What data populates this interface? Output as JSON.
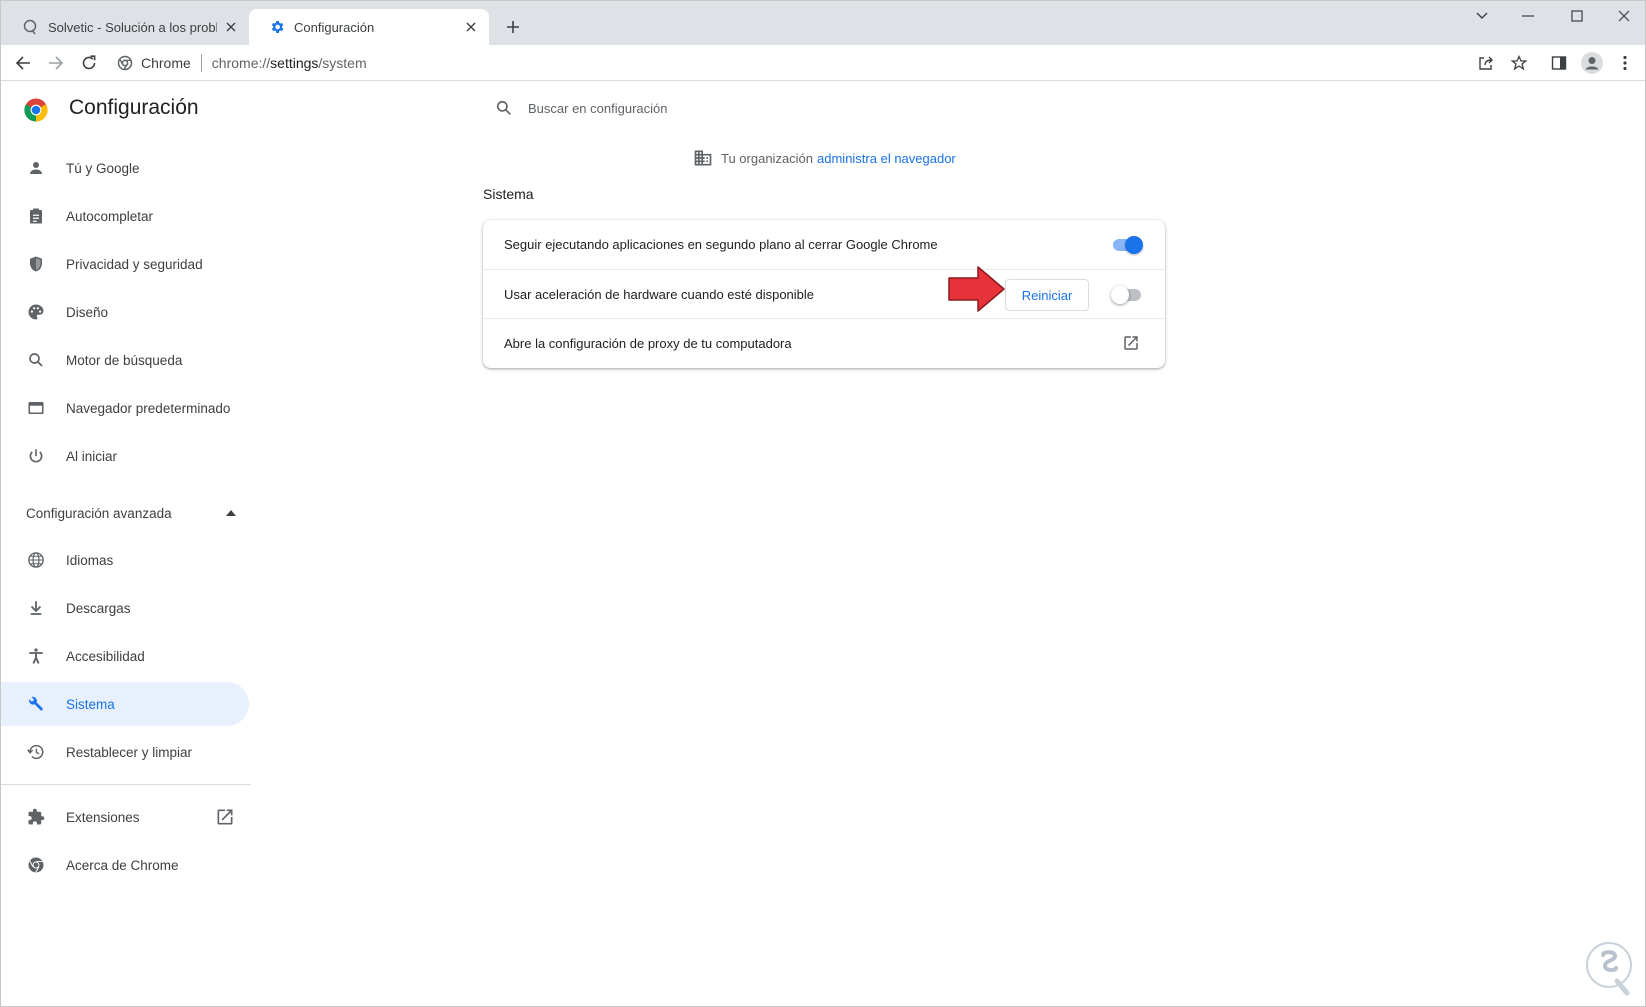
{
  "browser": {
    "tabs": [
      {
        "title": "Solvetic - Solución a los problem",
        "favicon": "solvetic-favicon",
        "active": false
      },
      {
        "title": "Configuración",
        "favicon": "settings-gear-icon",
        "active": true
      }
    ],
    "omnibox": {
      "site_name": "Chrome",
      "url_scheme": "chrome://",
      "url_host": "settings",
      "url_path": "/system"
    }
  },
  "settings": {
    "title": "Configuración",
    "search_placeholder": "Buscar en configuración",
    "nav_items": [
      {
        "label": "Tú y Google",
        "icon": "person-icon"
      },
      {
        "label": "Autocompletar",
        "icon": "assignment-icon"
      },
      {
        "label": "Privacidad y seguridad",
        "icon": "shield-icon"
      },
      {
        "label": "Diseño",
        "icon": "palette-icon"
      },
      {
        "label": "Motor de búsqueda",
        "icon": "search-icon"
      },
      {
        "label": "Navegador predeterminado",
        "icon": "web-browser-icon"
      },
      {
        "label": "Al iniciar",
        "icon": "power-icon"
      }
    ],
    "advanced_header": "Configuración avanzada",
    "advanced_items": [
      {
        "label": "Idiomas",
        "icon": "globe-icon"
      },
      {
        "label": "Descargas",
        "icon": "download-icon"
      },
      {
        "label": "Accesibilidad",
        "icon": "accessibility-icon"
      },
      {
        "label": "Sistema",
        "icon": "wrench-icon",
        "active": true
      },
      {
        "label": "Restablecer y limpiar",
        "icon": "restore-icon"
      }
    ],
    "footer_items": [
      {
        "label": "Extensiones",
        "icon": "puzzle-icon"
      },
      {
        "label": "Acerca de Chrome",
        "icon": "chrome-icon"
      }
    ]
  },
  "main": {
    "managed_notice": {
      "text": "Tu organización",
      "link": "administra el navegador"
    },
    "section_title": "Sistema",
    "rows": [
      {
        "label": "Seguir ejecutando aplicaciones en segundo plano al cerrar Google Chrome",
        "toggle": true
      },
      {
        "label": "Usar aceleración de hardware cuando esté disponible",
        "toggle": false,
        "button": "Reiniciar"
      },
      {
        "label": "Abre la configuración de proxy de tu computadora",
        "icon": "open-in-new-icon"
      }
    ]
  },
  "colors": {
    "accent": "#1a73e8",
    "annotation_arrow": "#e8323a",
    "tabstrip": "#dee1e6"
  }
}
